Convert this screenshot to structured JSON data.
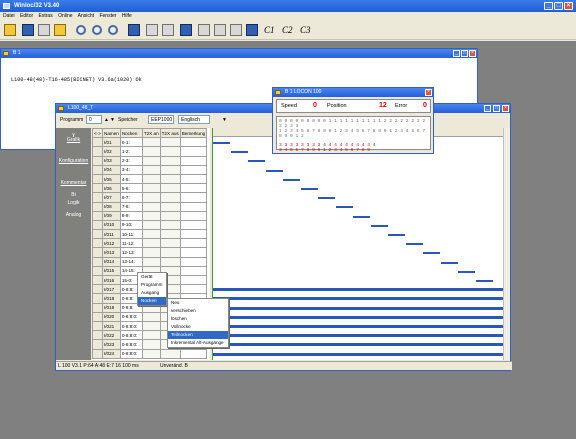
{
  "app": {
    "title": "Winloc/32 V3.40",
    "menu": [
      "Datei",
      "Editor",
      "Extras",
      "Online",
      "Ansicht",
      "Fenster",
      "Hilfe"
    ],
    "toolbar_text": [
      "C1",
      "C2",
      "C3"
    ]
  },
  "b1": {
    "title": "B 1",
    "line": "L100-48(48)-T16-485(BICNET) V3.6a(1020) Ok"
  },
  "locon": {
    "title": "B 1 LOCON 100",
    "speed_label": "Speed",
    "speed_value": "0",
    "position_label": "Position",
    "position_value": "12",
    "error_label": "Error",
    "error_value": "0",
    "bits_row1": "0 0 0 0 0 0 0 0 0 1 1 1 1 1 1 1 1 1 1 2 2 2 2 2 2 2 2 2 2 3 3",
    "bits_row2": "1 2 3 4 5 6 7 8 9 0 1 2 3 4 5 6 7 8 9 0 1 2 3 4 5 6 7 8 9 0 1 2",
    "bits_row3": "3 3 3 3 3 3 3 3 4 4 4 4 4 4 4 4 4 4",
    "bits_row4": "3 4 5 6 7 8 9 0 1 2 3 4 5 6 7 8 9"
  },
  "l100": {
    "title": "L100_48_T",
    "programm_label": "Programm",
    "programm_value": "0",
    "speicher_label": "Speicher",
    "speicher_value": "EEP1000",
    "lang_value": "Englisch",
    "nav": [
      "Grafik",
      "Konfiguration",
      "Kommentar",
      "Bi",
      "Logik",
      "Analog"
    ],
    "headers": [
      "<->",
      "Namen",
      "Nocken",
      "T2X an",
      "T2X aus",
      "Bemerkung"
    ],
    "rows": [
      [
        "I/01",
        "0-1:"
      ],
      [
        "I/02",
        "1-2:"
      ],
      [
        "I/03",
        "2-3:"
      ],
      [
        "I/04",
        "3-4:"
      ],
      [
        "I/05",
        "4-5:"
      ],
      [
        "I/06",
        "5-6:"
      ],
      [
        "I/07",
        "6-7:"
      ],
      [
        "I/08",
        "7-8:"
      ],
      [
        "I/09",
        "8-9:"
      ],
      [
        "I/010",
        "9-10:"
      ],
      [
        "I/011",
        "10-11:"
      ],
      [
        "I/012",
        "11-12:"
      ],
      [
        "I/013",
        "12-13:"
      ],
      [
        "I/014",
        "13-14:"
      ],
      [
        "I/015",
        "14-15:"
      ],
      [
        "I/016",
        "15-0:"
      ],
      [
        "I/017",
        "0-8:8:"
      ],
      [
        "I/018",
        "0-8:8:"
      ],
      [
        "I/019",
        "0-8:8:"
      ],
      [
        "I/020",
        "0-8:8:0:"
      ],
      [
        "I/021",
        "0-8:8:0:"
      ],
      [
        "I/022",
        "0-8:8:0:"
      ],
      [
        "I/023",
        "0-8:8:0:"
      ],
      [
        "I/024",
        "0-8:8:0:"
      ]
    ],
    "status_left": "L 100 V3.1 P:64 A:48 E:7 16 100 ms",
    "status_right": "Unveränd. B"
  },
  "menu1": [
    "Gerät",
    "Programm",
    "Ausgang",
    "Nocken"
  ],
  "menu2": [
    "Neu",
    "verschieben",
    "löschen",
    "Vollnocke",
    "Teilnocken",
    "Inkremental Alt-Ausgänge"
  ],
  "menu2_selected": 4
}
